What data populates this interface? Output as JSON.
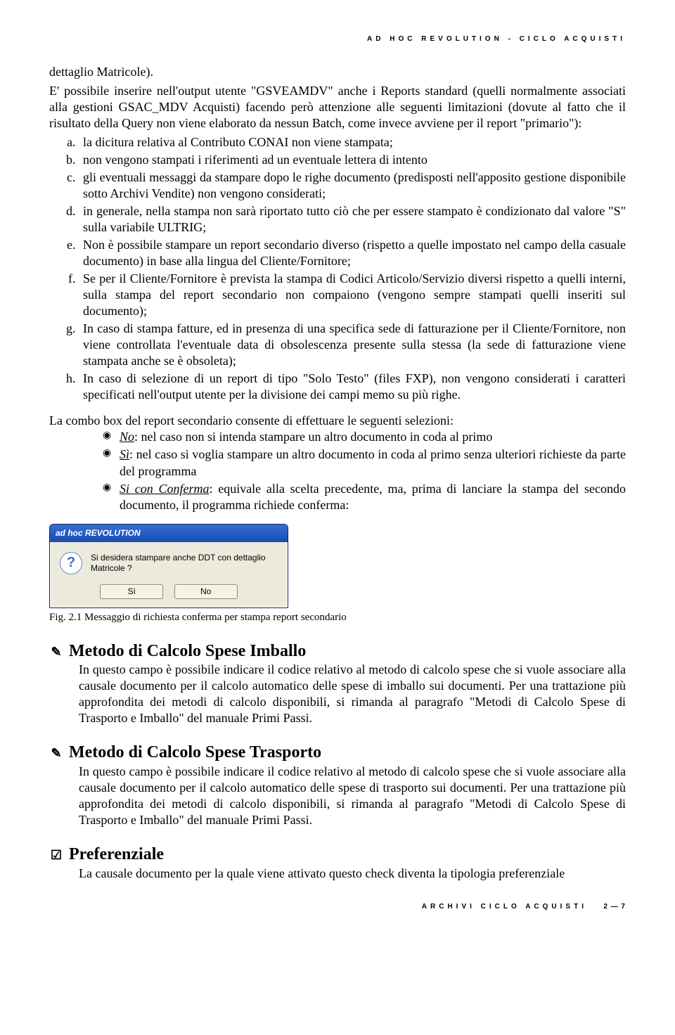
{
  "header": "AD HOC REVOLUTION - CICLO ACQUISTI",
  "intro": "dettaglio Matricole).",
  "intro2": "E' possibile inserire nell'output utente \"GSVEAMDV\" anche i Reports standard (quelli normalmente associati alla gestioni GSAC_MDV Acquisti) facendo però attenzione alle seguenti limitazioni (dovute al fatto che il risultato della Query non viene elaborato da nessun Batch, come invece avviene per il report \"primario\"):",
  "letters": {
    "a": "la dicitura relativa al Contributo CONAI non viene stampata;",
    "b": "non vengono stampati i riferimenti ad un eventuale lettera di intento",
    "c": "gli eventuali messaggi da stampare dopo le righe documento (predisposti nell'apposito gestione disponibile sotto Archivi Vendite) non vengono considerati;",
    "d": "in generale, nella stampa non sarà riportato tutto ciò che per essere stampato è condizionato dal valore \"S\" sulla variabile ULTRIG;",
    "e": "Non è possibile stampare un report secondario diverso (rispetto a quelle impostato nel campo della casuale documento) in base alla lingua del Cliente/Fornitore;",
    "f": "Se per il Cliente/Fornitore è prevista la stampa di Codici Articolo/Servizio diversi rispetto a quelli interni, sulla stampa del report secondario non compaiono (vengono sempre stampati quelli inseriti sul documento);",
    "g": "In caso di stampa fatture, ed in presenza di una specifica sede di fatturazione per il Cliente/Fornitore, non viene controllata l'eventuale data di obsolescenza presente sulla stessa (la sede di fatturazione viene stampata anche se è obsoleta);",
    "h": "In caso di selezione di un report di tipo \"Solo Testo\" (files FXP), non vengono considerati i caratteri specificati nell'output utente per la divisione dei campi memo su più righe."
  },
  "combo_intro": "La combo box del report secondario consente di effettuare le seguenti selezioni:",
  "bullets": {
    "no_label": "No",
    "no_text": ": nel caso non si intenda stampare un altro documento in coda al primo",
    "si_label": "Sì",
    "si_text": ": nel caso si voglia stampare un altro documento in coda al primo senza ulteriori richieste da parte del programma",
    "sic_label": "Si con Conferma",
    "sic_text": ": equivale alla scelta precedente, ma, prima di lanciare la stampa del secondo documento, il programma richiede conferma:"
  },
  "dialog": {
    "title": "ad hoc REVOLUTION",
    "message": "Si desidera stampare anche DDT con dettaglio Matricole ?",
    "yes": "Sì",
    "no": "No"
  },
  "caption": "Fig. 2.1 Messaggio di richiesta conferma per stampa report secondario",
  "sections": {
    "imballo_title": "Metodo di Calcolo Spese Imballo",
    "imballo_body": "In questo campo è possibile indicare il codice relativo al metodo di calcolo spese che si vuole associare alla causale documento per il calcolo automatico delle spese di imballo sui documenti. Per una trattazione più approfondita dei metodi di calcolo disponibili, si rimanda al paragrafo \"Metodi di Calcolo Spese di Trasporto e Imballo\" del manuale Primi Passi.",
    "trasporto_title": "Metodo di Calcolo Spese Trasporto",
    "trasporto_body": "In questo campo è possibile indicare il codice relativo al metodo di calcolo spese che si vuole associare alla causale documento per il calcolo automatico delle spese di trasporto sui documenti. Per una trattazione più approfondita dei metodi di calcolo disponibili, si rimanda al paragrafo \"Metodi di Calcolo Spese di Trasporto e Imballo\" del manuale Primi Passi.",
    "pref_title": "Preferenziale",
    "pref_body": "La causale documento per la quale viene attivato questo check diventa la tipologia preferenziale"
  },
  "footer": "ARCHIVI CICLO ACQUISTI",
  "page_number": "2 — 7"
}
